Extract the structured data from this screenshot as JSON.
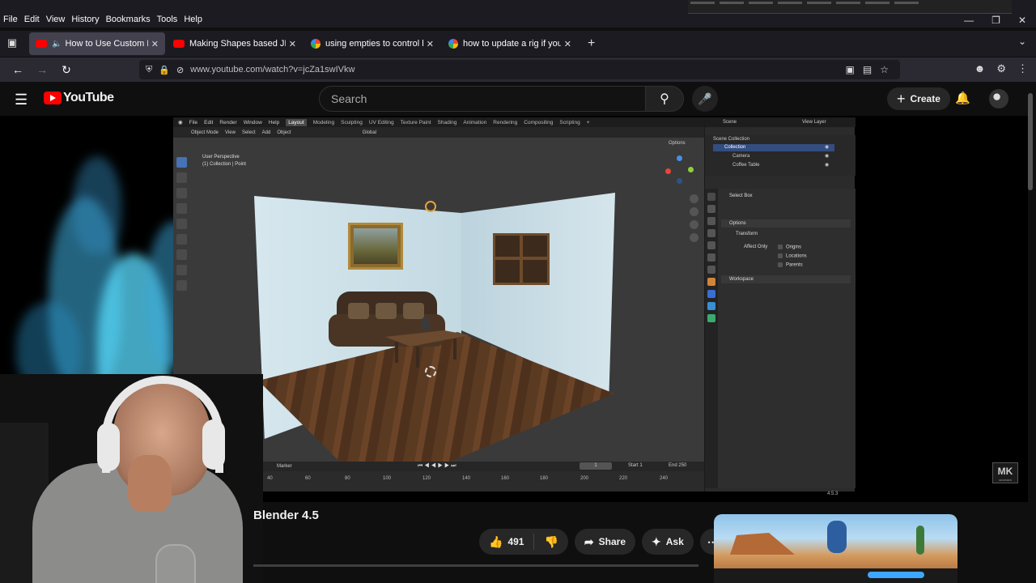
{
  "browser": {
    "menu": [
      "File",
      "Edit",
      "View",
      "History",
      "Bookmarks",
      "Tools",
      "Help"
    ],
    "tabs": [
      {
        "title": "How to Use Custom Proper",
        "favicon": "youtube",
        "active": true,
        "audio": true
      },
      {
        "title": "Making Shapes based JIGGLE C",
        "favicon": "youtube",
        "active": false
      },
      {
        "title": "using empties to control bones",
        "favicon": "google",
        "active": false
      },
      {
        "title": "how to update a rig if you alrea",
        "favicon": "google",
        "active": false
      }
    ],
    "url": "www.youtube.com/watch?v=jcZa1swIVkw"
  },
  "youtube": {
    "logo_text": "YouTube",
    "search_placeholder": "Search",
    "create_label": "Create",
    "video_title_visible": "Blender 4.5",
    "like_count": "491",
    "share_label": "Share",
    "ask_label": "Ask"
  },
  "blender": {
    "top_menu": [
      "File",
      "Edit",
      "Render",
      "Window",
      "Help"
    ],
    "workspaces": [
      "Layout",
      "Modeling",
      "Sculpting",
      "UV Editing",
      "Texture Paint",
      "Shading",
      "Animation",
      "Rendering",
      "Compositing",
      "Scripting"
    ],
    "active_workspace": "Layout",
    "header_items": [
      "Object Mode",
      "View",
      "Select",
      "Add",
      "Object"
    ],
    "transform_orientation": "Global",
    "options_label": "Options",
    "viewport_info": [
      "User Perspective",
      "(1) Collection | Point"
    ],
    "scene_label": "Scene",
    "view_layer_label": "View Layer",
    "outliner": {
      "root": "Scene Collection",
      "collection": "Collection",
      "items": [
        "Camera",
        "Coffee Table"
      ]
    },
    "tool_name": "Select Box",
    "props": {
      "options": "Options",
      "transform": "Transform",
      "affect_only": "Affect Only",
      "checkboxes": [
        "Origins",
        "Locations",
        "Parents"
      ],
      "workspace": "Workspace"
    },
    "timeline": {
      "marker_label": "Marker",
      "current_frame": "1",
      "start_label": "Start",
      "start_value": "1",
      "end_label": "End",
      "end_value": "250",
      "ticks": [
        "40",
        "60",
        "80",
        "100",
        "120",
        "140",
        "160",
        "180",
        "200",
        "220",
        "240"
      ]
    },
    "version": "4.5.3"
  },
  "overlay": {
    "logo_text": "MK",
    "logo_sub": "GRAPHICS"
  }
}
